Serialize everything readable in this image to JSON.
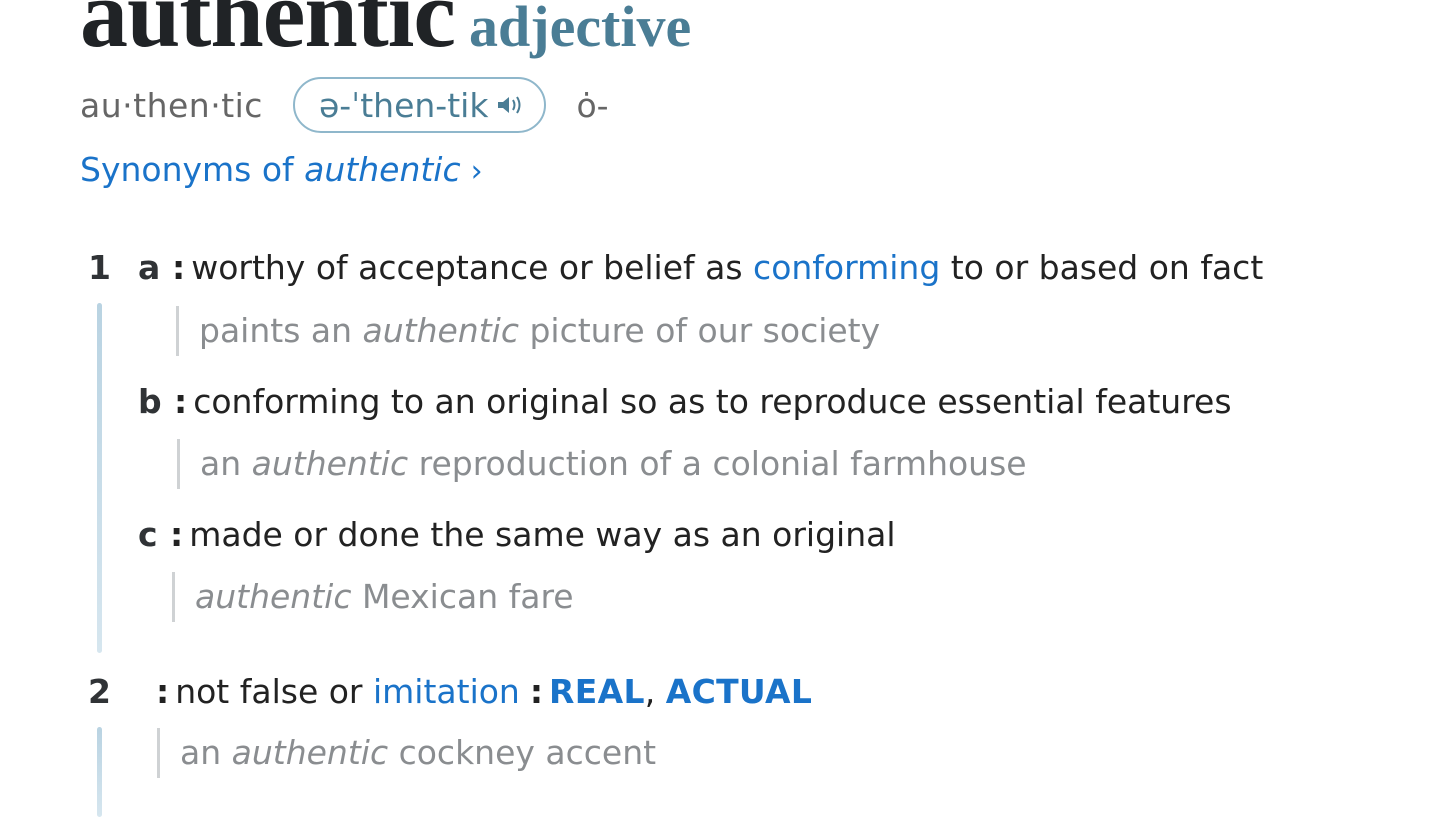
{
  "entry": {
    "headword": "authentic",
    "part_of_speech": "adjective",
    "syllables": "au·then·tic",
    "pronunciation": "ə-ˈthen-tik",
    "alt_pronunciation": "ȯ-",
    "synonyms_link": {
      "prefix": "Synonyms of ",
      "word": "authentic",
      "chevron": "›"
    }
  },
  "icons": {
    "speaker": "speaker-icon",
    "chevron": "chevron-right-icon"
  },
  "colors": {
    "link": "#1a73c9",
    "pos": "#4a7d95",
    "example": "#8a8d90",
    "sense_bar": "#b9d3e2"
  },
  "senses": [
    {
      "number": "1",
      "subsenses": [
        {
          "letter": "a",
          "def_before": "worthy of acceptance or belief as ",
          "def_link": "conforming",
          "def_after": " to or based on fact",
          "example_before": "paints an ",
          "example_italic": "authentic",
          "example_after": " picture of our society"
        },
        {
          "letter": "b",
          "def_text": "conforming to an original so as to reproduce essential features",
          "example_before": "an ",
          "example_italic": "authentic",
          "example_after": " reproduction of a colonial farmhouse"
        },
        {
          "letter": "c",
          "def_text": "made or done the same way as an original",
          "example_before": "",
          "example_italic": "authentic",
          "example_after": " Mexican fare"
        }
      ]
    },
    {
      "number": "2",
      "def_text": "not false or ",
      "def_link": "imitation",
      "synonyms": [
        "REAL",
        "ACTUAL"
      ],
      "example_before": "an ",
      "example_italic": "authentic",
      "example_after": " cockney accent"
    }
  ]
}
